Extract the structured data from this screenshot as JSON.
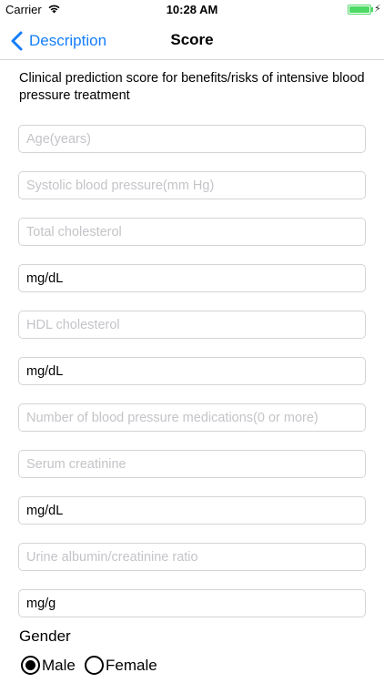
{
  "status_bar": {
    "carrier": "Carrier",
    "time": "10:28 AM",
    "battery_color": "#4cd964",
    "wifi_icon": "wifi-icon",
    "charge_icon": "charging-bolt-icon"
  },
  "nav": {
    "back_label": "Description",
    "title": "Score",
    "accent_color": "#147efb"
  },
  "description": "Clinical prediction score for benefits/risks of intensive blood pressure treatment",
  "fields": [
    {
      "placeholder": "Age(years)",
      "value": ""
    },
    {
      "placeholder": "Systolic blood pressure(mm Hg)",
      "value": ""
    },
    {
      "placeholder": "Total cholesterol",
      "value": ""
    },
    {
      "placeholder": "",
      "value": "mg/dL"
    },
    {
      "placeholder": "HDL cholesterol",
      "value": ""
    },
    {
      "placeholder": "",
      "value": "mg/dL"
    },
    {
      "placeholder": "Number of blood pressure medications(0 or more)",
      "value": ""
    },
    {
      "placeholder": "Serum creatinine",
      "value": ""
    },
    {
      "placeholder": "",
      "value": "mg/dL"
    },
    {
      "placeholder": "Urine albumin/creatinine ratio",
      "value": ""
    },
    {
      "placeholder": "",
      "value": "mg/g"
    }
  ],
  "gender": {
    "label": "Gender",
    "options": [
      {
        "label": "Male",
        "selected": true
      },
      {
        "label": "Female",
        "selected": false
      }
    ]
  }
}
